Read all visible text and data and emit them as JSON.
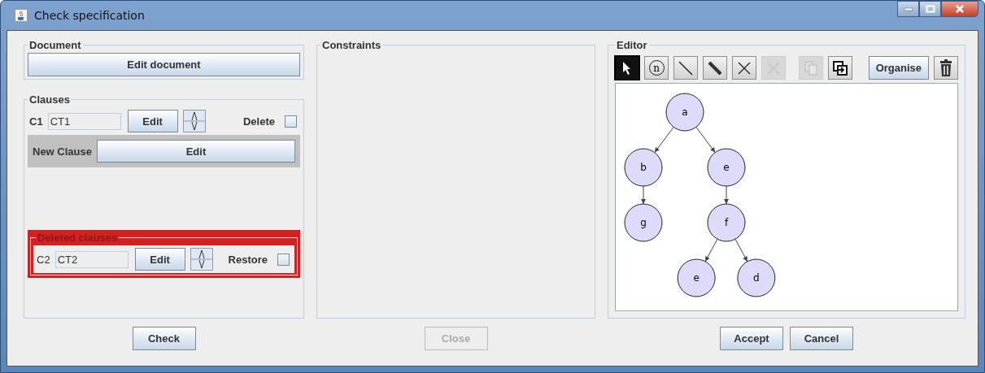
{
  "window": {
    "title": "Check specification"
  },
  "document": {
    "title": "Document",
    "button": "Edit document"
  },
  "clauses": {
    "title": "Clauses",
    "items": [
      {
        "id": "C1",
        "value": "CT1",
        "edit": "Edit",
        "action": "Delete",
        "checked": false
      }
    ],
    "new_clause": {
      "label": "New Clause",
      "button": "Edit"
    }
  },
  "deleted": {
    "title": "Deleted clauses",
    "items": [
      {
        "id": "C2",
        "value": "CT2",
        "edit": "Edit",
        "action": "Restore",
        "checked": false
      }
    ]
  },
  "check_button": "Check",
  "constraints": {
    "title": "Constraints"
  },
  "close_button": {
    "label": "Close",
    "disabled": true
  },
  "editor": {
    "title": "Editor",
    "tools": [
      {
        "kind": "select",
        "selected": true,
        "disabled": false
      },
      {
        "kind": "node",
        "label": "n",
        "selected": false,
        "disabled": false
      },
      {
        "kind": "line",
        "selected": false,
        "disabled": false
      },
      {
        "kind": "double-line",
        "selected": false,
        "disabled": false
      },
      {
        "kind": "cross",
        "selected": false,
        "disabled": false
      },
      {
        "kind": "cross",
        "selected": false,
        "disabled": true
      },
      {
        "kind": "copy",
        "selected": false,
        "disabled": true
      },
      {
        "kind": "paste",
        "selected": false,
        "disabled": false
      }
    ],
    "organise": "Organise",
    "graph": {
      "label": "a",
      "children": [
        {
          "label": "b",
          "children": [
            {
              "label": "g"
            }
          ]
        },
        {
          "label": "e",
          "children": [
            {
              "label": "f",
              "children": [
                {
                  "label": "e"
                },
                {
                  "label": "d"
                }
              ]
            }
          ]
        }
      ]
    }
  },
  "buttons": [
    "Accept",
    "Cancel"
  ]
}
